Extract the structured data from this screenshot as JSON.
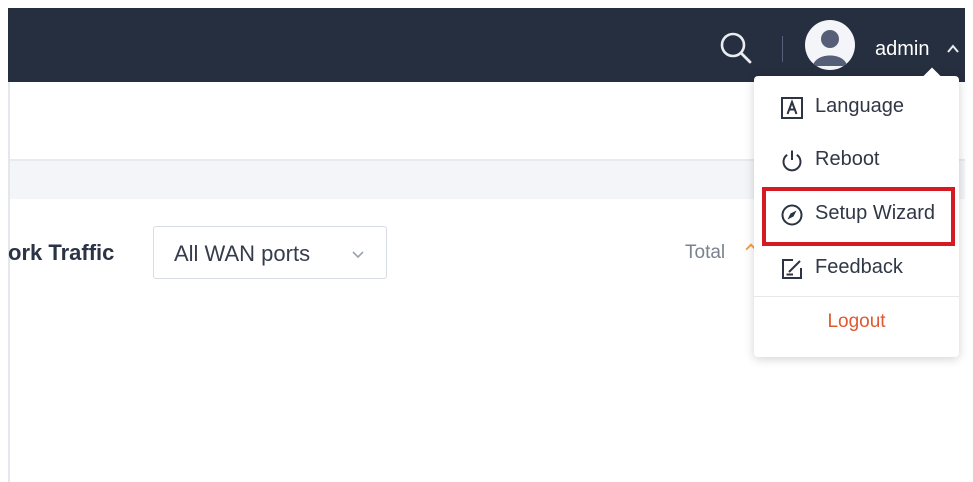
{
  "header": {
    "user_name": "admin",
    "icons": {
      "search": "search-icon",
      "avatar": "user-avatar-icon",
      "menu_toggle": "chevron-up-icon"
    },
    "colors": {
      "bar": "#262f3f"
    }
  },
  "user_menu": {
    "items": [
      {
        "label": "Language",
        "icon": "language-icon"
      },
      {
        "label": "Reboot",
        "icon": "power-icon"
      },
      {
        "label": "Setup Wizard",
        "icon": "compass-icon",
        "highlighted": true
      },
      {
        "label": "Feedback",
        "icon": "feedback-edit-icon"
      }
    ],
    "logout_label": "Logout",
    "colors": {
      "logout": "#e0582f",
      "highlight_box": "#d61a24"
    }
  },
  "main": {
    "section_title": "ork Traffic",
    "wan_select": {
      "value": "All WAN ports"
    },
    "total_label": "Total"
  }
}
